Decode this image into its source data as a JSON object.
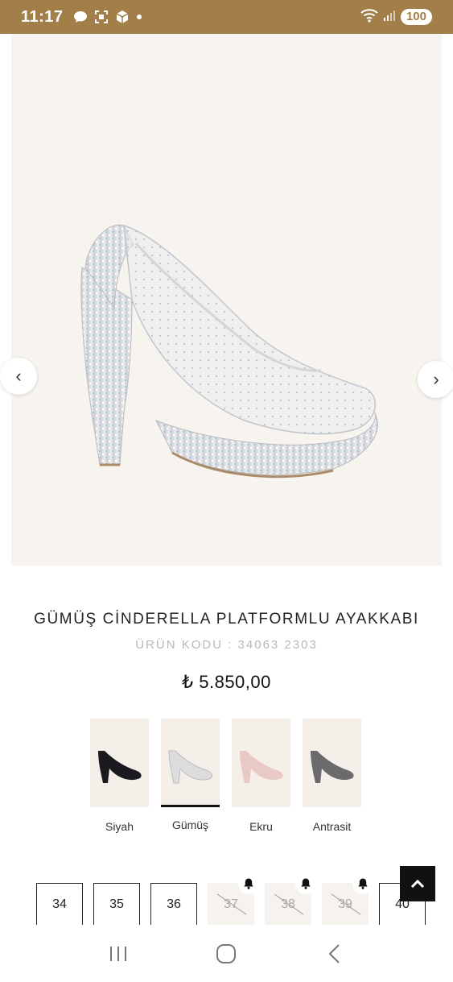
{
  "status_bar": {
    "time": "11:17",
    "battery": "100",
    "icons": [
      "chat-icon",
      "screenshot-icon",
      "package-icon",
      "dot-icon",
      "wifi-icon",
      "signal-icon"
    ]
  },
  "gallery": {
    "prev_label": "‹",
    "next_label": "›",
    "image": "silver-platform-heel-image"
  },
  "product": {
    "title": "GÜMÜŞ CİNDERELLA PLATFORMLU AYAKKABI",
    "code": "ÜRÜN KODU : 34063 2303",
    "price": "₺ 5.850,00"
  },
  "colors": [
    {
      "label": "Siyah",
      "color": "#1a1a1f",
      "selected": false
    },
    {
      "label": "Gümüş",
      "color": "#dcdcdc",
      "selected": true
    },
    {
      "label": "Ekru",
      "color": "#e8c9c4",
      "selected": false
    },
    {
      "label": "Antrasit",
      "color": "#6b6b6e",
      "selected": false
    }
  ],
  "sizes": [
    {
      "label": "34",
      "available": true
    },
    {
      "label": "35",
      "available": true
    },
    {
      "label": "36",
      "available": true
    },
    {
      "label": "37",
      "available": false
    },
    {
      "label": "38",
      "available": false
    },
    {
      "label": "39",
      "available": false
    },
    {
      "label": "40",
      "available": true
    }
  ],
  "theme": {
    "status_bar_color": "#a27f49",
    "gallery_bg": "#f7f3ef"
  }
}
